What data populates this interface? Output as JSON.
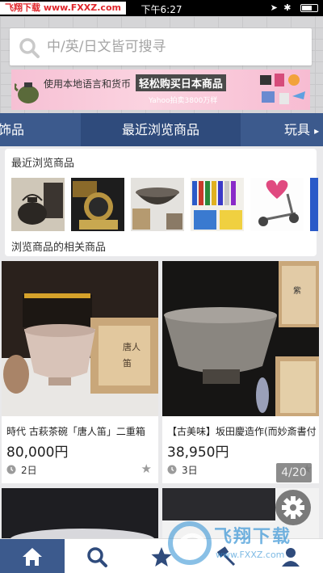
{
  "status_bar": {
    "carrier": "飞翔下载 www.FXXZ.com",
    "time": "下午6:27"
  },
  "search": {
    "placeholder": "中/英/日文皆可搜寻"
  },
  "banner": {
    "text_prefix": "使用本地语言和货币",
    "text_highlight": "轻松购买日本商品",
    "subtext": "Yahoo拍卖3800万样"
  },
  "category_tabs": [
    {
      "label": "饰品",
      "active": false
    },
    {
      "label": "最近浏览商品",
      "active": true
    },
    {
      "label": "玩具",
      "active": false
    }
  ],
  "recent": {
    "title": "最近浏览商品",
    "related_title": "浏览商品的相关商品"
  },
  "products": [
    {
      "name": "時代 古萩茶碗「唐人笛」二重箱",
      "price": "80,000円",
      "days": "2日"
    },
    {
      "name": "【古美味】坂田慶造作(而妙斎書付)",
      "price": "38,950円",
      "days": "3日"
    }
  ],
  "page_indicator": "4/20",
  "watermark": {
    "text": "飞翔下载",
    "url": "www.FXXZ.com"
  },
  "colors": {
    "nav_blue": "#3c5a8d",
    "carrier_red": "#e0262b"
  }
}
